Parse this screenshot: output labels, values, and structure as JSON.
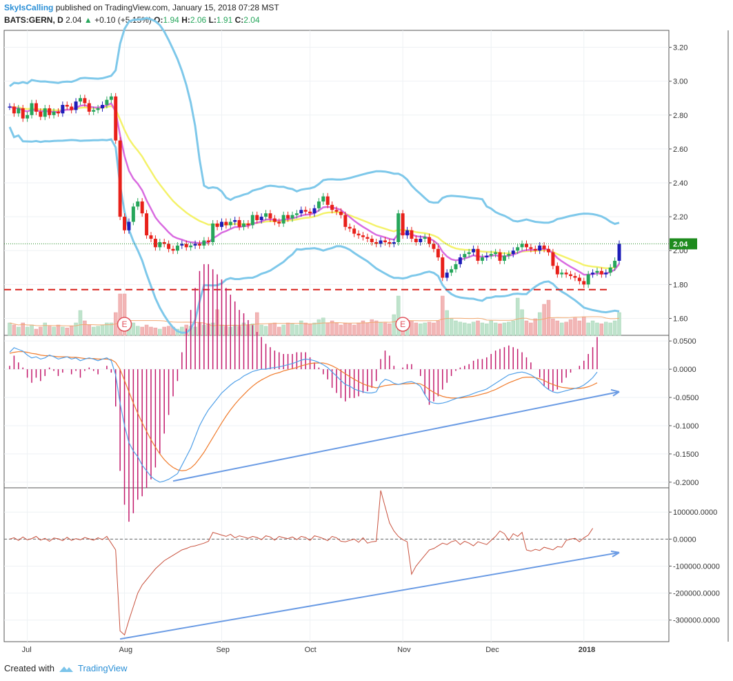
{
  "header": {
    "author": "SkyIsCalling",
    "published_text": "published on TradingView.com, January 15, 2018 07:28 MST",
    "symbol": "BATS:GERN, D",
    "price": "2.04",
    "change": "+0.10 (+5.15%)",
    "o_label": "O:",
    "o_value": "1.94",
    "h_label": "H:",
    "h_value": "2.06",
    "l_label": "L:",
    "l_value": "1.91",
    "c_label": "C:",
    "c_value": "2.04"
  },
  "footer": {
    "created_with": "Created with",
    "brand": "TradingView"
  },
  "colors": {
    "bull": "#26a65b",
    "bear": "#e8201a",
    "bull_alt": "#1d1db8",
    "bear_alt": "#e8201a",
    "bollinger": "#7ec8ea",
    "ema_fast": "#d96be0",
    "ema_slow": "#f4f26a",
    "macd_line": "#4f9fe8",
    "signal_line": "#f07a2a",
    "histogram": "#c2186b",
    "cci_line": "#c8503c",
    "support_line": "#d8201a",
    "divergence_arrow": "#6a9be4",
    "current_price_tag": "#1e8b1e"
  },
  "chart_data": [
    {
      "type": "candlestick",
      "panel": "price",
      "ylim": [
        1.5,
        3.3
      ],
      "y_ticks": [
        "3.20",
        "3.00",
        "2.80",
        "2.60",
        "2.40",
        "2.20",
        "2.00",
        "1.80",
        "1.60"
      ],
      "x_labels": [
        "Jul",
        "Aug",
        "Sep",
        "Oct",
        "Nov",
        "Dec",
        "2018"
      ],
      "x_label_index": [
        4,
        26,
        48,
        68,
        89,
        109,
        130
      ],
      "close": [
        2.85,
        2.81,
        2.84,
        2.78,
        2.8,
        2.87,
        2.82,
        2.79,
        2.84,
        2.8,
        2.82,
        2.81,
        2.86,
        2.85,
        2.83,
        2.88,
        2.9,
        2.87,
        2.82,
        2.83,
        2.84,
        2.86,
        2.89,
        2.91,
        2.65,
        2.2,
        2.12,
        2.17,
        2.26,
        2.29,
        2.22,
        2.09,
        2.07,
        2.02,
        2.05,
        2.04,
        2.01,
        2.0,
        2.03,
        2.04,
        2.02,
        2.03,
        2.04,
        2.03,
        2.06,
        2.05,
        2.16,
        2.14,
        2.17,
        2.15,
        2.17,
        2.18,
        2.14,
        2.16,
        2.15,
        2.21,
        2.18,
        2.2,
        2.22,
        2.19,
        2.17,
        2.16,
        2.21,
        2.19,
        2.21,
        2.22,
        2.24,
        2.23,
        2.22,
        2.25,
        2.29,
        2.32,
        2.27,
        2.24,
        2.23,
        2.21,
        2.14,
        2.13,
        2.1,
        2.09,
        2.08,
        2.07,
        2.05,
        2.04,
        2.06,
        2.05,
        2.04,
        2.05,
        2.22,
        2.09,
        2.12,
        2.07,
        2.05,
        2.07,
        2.08,
        2.04,
        2.01,
        1.96,
        1.84,
        1.87,
        1.89,
        1.92,
        1.96,
        1.98,
        1.99,
        2.01,
        1.94,
        1.96,
        1.97,
        1.98,
        1.99,
        1.94,
        1.97,
        1.98,
        2.0,
        2.02,
        2.04,
        2.02,
        2.01,
        2.0,
        2.03,
        2.01,
        1.99,
        1.91,
        1.86,
        1.87,
        1.86,
        1.85,
        1.84,
        1.82,
        1.8,
        1.86,
        1.87,
        1.88,
        1.86,
        1.87,
        1.9,
        1.94,
        2.04
      ],
      "volume_relative": [
        0.3,
        0.25,
        0.2,
        0.3,
        0.2,
        0.25,
        0.15,
        0.2,
        0.3,
        0.22,
        0.2,
        0.25,
        0.2,
        0.18,
        0.22,
        0.3,
        0.6,
        0.35,
        0.25,
        0.2,
        0.22,
        0.25,
        0.3,
        0.3,
        0.55,
        1.0,
        1.0,
        0.25,
        0.3,
        0.22,
        0.2,
        0.25,
        0.2,
        0.18,
        0.15,
        0.2,
        0.22,
        0.2,
        0.15,
        0.2,
        0.25,
        0.22,
        0.2,
        0.3,
        0.25,
        0.28,
        0.3,
        0.62,
        0.25,
        0.22,
        0.2,
        0.25,
        0.22,
        0.3,
        0.25,
        0.28,
        0.55,
        0.25,
        0.22,
        0.28,
        0.3,
        0.2,
        0.25,
        0.3,
        0.28,
        0.25,
        0.35,
        0.3,
        0.28,
        0.3,
        0.38,
        0.42,
        0.3,
        0.35,
        0.3,
        0.25,
        0.3,
        0.28,
        0.25,
        0.3,
        0.35,
        0.3,
        0.38,
        0.35,
        0.32,
        0.3,
        0.28,
        0.5,
        0.95,
        0.4,
        0.3,
        0.35,
        0.3,
        0.28,
        0.3,
        0.32,
        0.3,
        0.35,
        0.95,
        0.6,
        0.4,
        0.35,
        0.32,
        0.3,
        0.28,
        0.32,
        0.35,
        0.3,
        0.28,
        0.35,
        0.3,
        0.28,
        0.3,
        0.32,
        0.35,
        0.9,
        0.62,
        0.35,
        0.3,
        0.4,
        0.55,
        0.75,
        0.85,
        0.4,
        0.35,
        0.3,
        0.32,
        0.38,
        0.42,
        0.35,
        0.45,
        0.3,
        0.35,
        0.3,
        0.28,
        0.32,
        0.3,
        0.35,
        0.55
      ],
      "support_level": 1.77,
      "earnings_markers": [
        "E",
        "E"
      ],
      "earnings_index": [
        26,
        89
      ],
      "last_price_label": "2.04"
    },
    {
      "type": "line",
      "panel": "macd",
      "ylim": [
        -0.21,
        0.06
      ],
      "y_ticks": [
        "0.0500",
        "0.0000",
        "-0.0500",
        "-0.1000",
        "-0.1500",
        "-0.2000"
      ],
      "series": [
        {
          "role": "macd",
          "values": [
            0.03,
            0.038,
            0.035,
            0.032,
            0.025,
            0.02,
            0.022,
            0.018,
            0.02,
            0.025,
            0.022,
            0.018,
            0.02,
            0.022,
            0.018,
            0.02,
            0.015,
            0.018,
            0.02,
            0.018,
            0.015,
            0.018,
            0.02,
            0.015,
            -0.01,
            -0.06,
            -0.1,
            -0.13,
            -0.145,
            -0.155,
            -0.17,
            -0.18,
            -0.19,
            -0.196,
            -0.2,
            -0.198,
            -0.195,
            -0.19,
            -0.185,
            -0.17,
            -0.155,
            -0.14,
            -0.12,
            -0.1,
            -0.085,
            -0.072,
            -0.062,
            -0.052,
            -0.042,
            -0.035,
            -0.028,
            -0.022,
            -0.018,
            -0.012,
            -0.008,
            -0.004,
            -0.002,
            0.0,
            0.0,
            0.002,
            0.003,
            0.004,
            0.006,
            0.008,
            0.01,
            0.013,
            0.016,
            0.018,
            0.017,
            0.015,
            0.012,
            0.008,
            0.003,
            -0.005,
            -0.012,
            -0.02,
            -0.027,
            -0.03,
            -0.035,
            -0.038,
            -0.04,
            -0.042,
            -0.042,
            -0.04,
            -0.025,
            -0.018,
            -0.02,
            -0.025,
            -0.027,
            -0.025,
            -0.023,
            -0.022,
            -0.025,
            -0.03,
            -0.045,
            -0.057,
            -0.06,
            -0.061,
            -0.06,
            -0.058,
            -0.055,
            -0.052,
            -0.05,
            -0.048,
            -0.046,
            -0.043,
            -0.04,
            -0.038,
            -0.035,
            -0.03,
            -0.025,
            -0.02,
            -0.015,
            -0.01,
            -0.008,
            -0.006,
            -0.005,
            -0.007,
            -0.01,
            -0.015,
            -0.022,
            -0.03,
            -0.036,
            -0.04,
            -0.042,
            -0.04,
            -0.038,
            -0.036,
            -0.034,
            -0.032,
            -0.028,
            -0.022,
            -0.015,
            -0.005
          ]
        },
        {
          "role": "signal",
          "values": [
            0.028,
            0.03,
            0.031,
            0.031,
            0.03,
            0.028,
            0.027,
            0.025,
            0.024,
            0.024,
            0.023,
            0.022,
            0.022,
            0.022,
            0.021,
            0.021,
            0.02,
            0.019,
            0.019,
            0.019,
            0.018,
            0.018,
            0.018,
            0.017,
            0.012,
            0.0,
            -0.02,
            -0.04,
            -0.06,
            -0.078,
            -0.095,
            -0.11,
            -0.125,
            -0.138,
            -0.15,
            -0.16,
            -0.168,
            -0.174,
            -0.178,
            -0.18,
            -0.179,
            -0.175,
            -0.168,
            -0.158,
            -0.147,
            -0.134,
            -0.121,
            -0.108,
            -0.095,
            -0.083,
            -0.072,
            -0.062,
            -0.053,
            -0.045,
            -0.037,
            -0.03,
            -0.024,
            -0.019,
            -0.015,
            -0.011,
            -0.008,
            -0.006,
            -0.003,
            -0.001,
            0.001,
            0.003,
            0.006,
            0.008,
            0.01,
            0.011,
            0.011,
            0.011,
            0.009,
            0.006,
            0.002,
            -0.003,
            -0.008,
            -0.013,
            -0.018,
            -0.022,
            -0.026,
            -0.029,
            -0.031,
            -0.033,
            -0.031,
            -0.029,
            -0.028,
            -0.027,
            -0.027,
            -0.026,
            -0.026,
            -0.025,
            -0.025,
            -0.026,
            -0.03,
            -0.036,
            -0.041,
            -0.045,
            -0.048,
            -0.05,
            -0.051,
            -0.051,
            -0.051,
            -0.05,
            -0.049,
            -0.048,
            -0.046,
            -0.044,
            -0.042,
            -0.039,
            -0.036,
            -0.032,
            -0.028,
            -0.024,
            -0.021,
            -0.018,
            -0.015,
            -0.014,
            -0.014,
            -0.015,
            -0.017,
            -0.02,
            -0.024,
            -0.027,
            -0.03,
            -0.032,
            -0.033,
            -0.034,
            -0.034,
            -0.034,
            -0.033,
            -0.031,
            -0.028,
            -0.024
          ]
        }
      ],
      "divergence_arrow": {
        "from": [
          37,
          -0.198
        ],
        "to": [
          138,
          -0.04
        ]
      }
    },
    {
      "type": "line",
      "panel": "cci",
      "ylim": [
        -380000,
        190000
      ],
      "y_ticks": [
        "100000.0000",
        "0.0000",
        "-100000.0000",
        "-200000.0000",
        "-300000.0000"
      ],
      "values": [
        0,
        5000,
        -5000,
        8000,
        -3000,
        2000,
        10000,
        -4000,
        3000,
        -8000,
        4000,
        1000,
        -6000,
        7000,
        -5000,
        2000,
        -3000,
        6000,
        1000,
        -4000,
        5000,
        -2000,
        10000,
        -15000,
        -40000,
        -340000,
        -355000,
        -300000,
        -250000,
        -200000,
        -170000,
        -150000,
        -130000,
        -110000,
        -95000,
        -80000,
        -70000,
        -60000,
        -50000,
        -40000,
        -35000,
        -28000,
        -25000,
        -20000,
        -15000,
        -8000,
        25000,
        20000,
        15000,
        10000,
        18000,
        5000,
        12000,
        8000,
        3000,
        10000,
        6000,
        -2000,
        12000,
        8000,
        -4000,
        10000,
        5000,
        2000,
        8000,
        -2000,
        10000,
        6000,
        -5000,
        12000,
        8000,
        2000,
        -6000,
        10000,
        5000,
        -8000,
        -10000,
        -5000,
        0,
        -12000,
        5000,
        -15000,
        -10000,
        -8000,
        180000,
        120000,
        60000,
        30000,
        10000,
        -2000,
        -10000,
        -130000,
        -100000,
        -80000,
        -60000,
        -40000,
        -35000,
        -25000,
        -15000,
        -20000,
        -10000,
        -5000,
        -20000,
        -8000,
        -15000,
        -25000,
        -10000,
        -15000,
        -20000,
        -5000,
        10000,
        30000,
        20000,
        -5000,
        20000,
        10000,
        25000,
        -40000,
        -45000,
        -38000,
        -42000,
        -30000,
        -35000,
        -40000,
        -28000,
        -30000,
        -5000,
        0,
        3000,
        -10000,
        5000,
        15000,
        40000
      ],
      "divergence_arrow": {
        "from": [
          25,
          -370000
        ],
        "to": [
          138,
          -50000
        ]
      }
    }
  ]
}
